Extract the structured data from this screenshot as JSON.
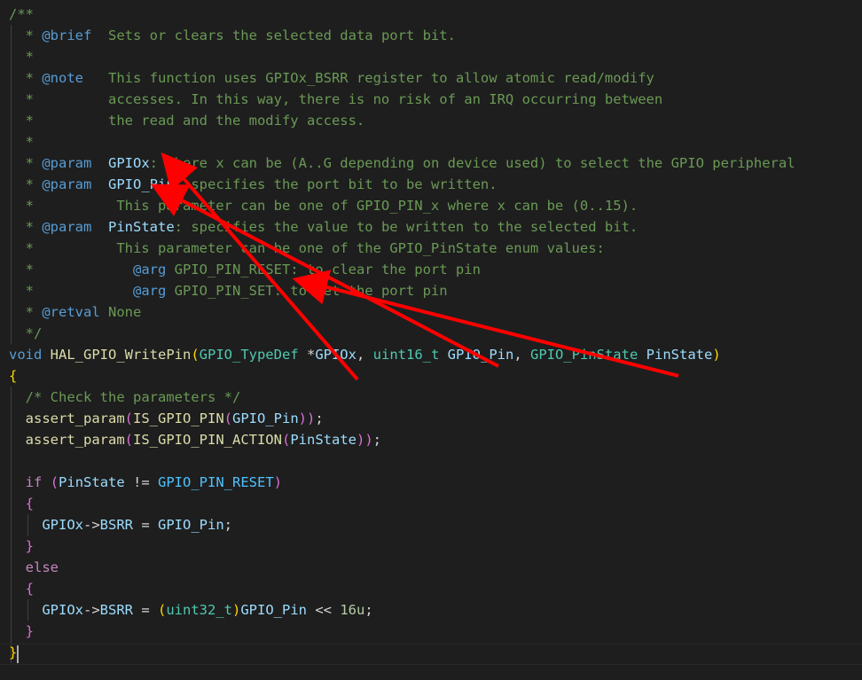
{
  "editor": {
    "colors": {
      "background": "#1e1e1e",
      "comment": "#6a9955",
      "keyword": "#569cd6",
      "control": "#c586c0",
      "type": "#4ec9b0",
      "function": "#dcdcaa",
      "macro": "#4fc1ff",
      "variable": "#9cdcfe",
      "number": "#b5cea8",
      "arrow": "#ff0000"
    },
    "lines": [
      [
        {
          "cls": "c",
          "text": "/**"
        }
      ],
      [
        {
          "cls": "c",
          "text": "  * "
        },
        {
          "cls": "ct",
          "text": "@brief"
        },
        {
          "cls": "c",
          "text": "  Sets or clears the selected data port bit."
        }
      ],
      [
        {
          "cls": "c",
          "text": "  *"
        }
      ],
      [
        {
          "cls": "c",
          "text": "  * "
        },
        {
          "cls": "ct",
          "text": "@note"
        },
        {
          "cls": "c",
          "text": "   This function uses GPIOx_BSRR register to allow atomic read/modify"
        }
      ],
      [
        {
          "cls": "c",
          "text": "  *         accesses. In this way, there is no risk of an IRQ occurring between"
        }
      ],
      [
        {
          "cls": "c",
          "text": "  *         the read and the modify access."
        }
      ],
      [
        {
          "cls": "c",
          "text": "  *"
        }
      ],
      [
        {
          "cls": "c",
          "text": "  * "
        },
        {
          "cls": "ct",
          "text": "@param"
        },
        {
          "cls": "c",
          "text": "  "
        },
        {
          "cls": "cn",
          "text": "GPIOx"
        },
        {
          "cls": "c",
          "text": ": where x can be (A..G depending on device used) to select the GPIO peripheral"
        }
      ],
      [
        {
          "cls": "c",
          "text": "  * "
        },
        {
          "cls": "ct",
          "text": "@param"
        },
        {
          "cls": "c",
          "text": "  "
        },
        {
          "cls": "cn",
          "text": "GPIO_Pin"
        },
        {
          "cls": "c",
          "text": ": specifies the port bit to be written."
        }
      ],
      [
        {
          "cls": "c",
          "text": "  *          This parameter can be one of GPIO_PIN_x where x can be (0..15)."
        }
      ],
      [
        {
          "cls": "c",
          "text": "  * "
        },
        {
          "cls": "ct",
          "text": "@param"
        },
        {
          "cls": "c",
          "text": "  "
        },
        {
          "cls": "cn",
          "text": "PinState"
        },
        {
          "cls": "c",
          "text": ": specifies the value to be written to the selected bit."
        }
      ],
      [
        {
          "cls": "c",
          "text": "  *          This parameter can be one of the GPIO_PinState enum values:"
        }
      ],
      [
        {
          "cls": "c",
          "text": "  *            "
        },
        {
          "cls": "ct",
          "text": "@arg"
        },
        {
          "cls": "c",
          "text": " GPIO_PIN_RESET: to clear the port pin"
        }
      ],
      [
        {
          "cls": "c",
          "text": "  *            "
        },
        {
          "cls": "ct",
          "text": "@arg"
        },
        {
          "cls": "c",
          "text": " GPIO_PIN_SET: to set the port pin"
        }
      ],
      [
        {
          "cls": "c",
          "text": "  * "
        },
        {
          "cls": "ct",
          "text": "@retval"
        },
        {
          "cls": "c",
          "text": " None"
        }
      ],
      [
        {
          "cls": "c",
          "text": "  */"
        }
      ],
      [
        {
          "cls": "k",
          "text": "void"
        },
        {
          "cls": "p",
          "text": " "
        },
        {
          "cls": "f",
          "text": "HAL_GPIO_WritePin"
        },
        {
          "cls": "b",
          "text": "("
        },
        {
          "cls": "t",
          "text": "GPIO_TypeDef"
        },
        {
          "cls": "p",
          "text": " *"
        },
        {
          "cls": "v",
          "text": "GPIOx"
        },
        {
          "cls": "p",
          "text": ", "
        },
        {
          "cls": "t",
          "text": "uint16_t"
        },
        {
          "cls": "p",
          "text": " "
        },
        {
          "cls": "v",
          "text": "GPIO_Pin"
        },
        {
          "cls": "p",
          "text": ", "
        },
        {
          "cls": "t",
          "text": "GPIO_PinState"
        },
        {
          "cls": "p",
          "text": " "
        },
        {
          "cls": "v",
          "text": "PinState"
        },
        {
          "cls": "b",
          "text": ")"
        }
      ],
      [
        {
          "cls": "b",
          "text": "{"
        }
      ],
      [
        {
          "cls": "p",
          "text": "  "
        },
        {
          "cls": "c",
          "text": "/* Check the parameters */"
        }
      ],
      [
        {
          "cls": "p",
          "text": "  "
        },
        {
          "cls": "f",
          "text": "assert_param"
        },
        {
          "cls": "b2",
          "text": "("
        },
        {
          "cls": "f",
          "text": "IS_GPIO_PIN"
        },
        {
          "cls": "b2",
          "text": "("
        },
        {
          "cls": "v",
          "text": "GPIO_Pin"
        },
        {
          "cls": "b2",
          "text": "))"
        },
        {
          "cls": "p",
          "text": ";"
        }
      ],
      [
        {
          "cls": "p",
          "text": "  "
        },
        {
          "cls": "f",
          "text": "assert_param"
        },
        {
          "cls": "b2",
          "text": "("
        },
        {
          "cls": "f",
          "text": "IS_GPIO_PIN_ACTION"
        },
        {
          "cls": "b2",
          "text": "("
        },
        {
          "cls": "v",
          "text": "PinState"
        },
        {
          "cls": "b2",
          "text": "))"
        },
        {
          "cls": "p",
          "text": ";"
        }
      ],
      [
        {
          "cls": "p",
          "text": ""
        }
      ],
      [
        {
          "cls": "p",
          "text": "  "
        },
        {
          "cls": "kc",
          "text": "if"
        },
        {
          "cls": "p",
          "text": " "
        },
        {
          "cls": "b2",
          "text": "("
        },
        {
          "cls": "v",
          "text": "PinState"
        },
        {
          "cls": "p",
          "text": " != "
        },
        {
          "cls": "m",
          "text": "GPIO_PIN_RESET"
        },
        {
          "cls": "b2",
          "text": ")"
        }
      ],
      [
        {
          "cls": "p",
          "text": "  "
        },
        {
          "cls": "b2",
          "text": "{"
        }
      ],
      [
        {
          "cls": "p",
          "text": "    "
        },
        {
          "cls": "v",
          "text": "GPIOx"
        },
        {
          "cls": "p",
          "text": "->"
        },
        {
          "cls": "v",
          "text": "BSRR"
        },
        {
          "cls": "p",
          "text": " = "
        },
        {
          "cls": "v",
          "text": "GPIO_Pin"
        },
        {
          "cls": "p",
          "text": ";"
        }
      ],
      [
        {
          "cls": "p",
          "text": "  "
        },
        {
          "cls": "b2",
          "text": "}"
        }
      ],
      [
        {
          "cls": "p",
          "text": "  "
        },
        {
          "cls": "kc",
          "text": "else"
        }
      ],
      [
        {
          "cls": "p",
          "text": "  "
        },
        {
          "cls": "b2",
          "text": "{"
        }
      ],
      [
        {
          "cls": "p",
          "text": "    "
        },
        {
          "cls": "v",
          "text": "GPIOx"
        },
        {
          "cls": "p",
          "text": "->"
        },
        {
          "cls": "v",
          "text": "BSRR"
        },
        {
          "cls": "p",
          "text": " = "
        },
        {
          "cls": "b",
          "text": "("
        },
        {
          "cls": "t",
          "text": "uint32_t"
        },
        {
          "cls": "b",
          "text": ")"
        },
        {
          "cls": "v",
          "text": "GPIO_Pin"
        },
        {
          "cls": "p",
          "text": " << "
        },
        {
          "cls": "n",
          "text": "16u"
        },
        {
          "cls": "p",
          "text": ";"
        }
      ],
      [
        {
          "cls": "p",
          "text": "  "
        },
        {
          "cls": "b2",
          "text": "}"
        }
      ],
      [
        {
          "cls": "b",
          "text": "}"
        }
      ]
    ]
  }
}
